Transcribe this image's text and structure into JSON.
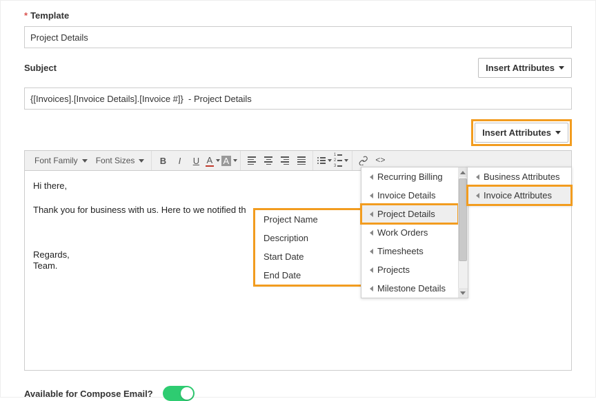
{
  "template": {
    "label": "Template",
    "value": "Project Details"
  },
  "subject": {
    "label": "Subject",
    "value": "{[Invoices].[Invoice Details].[Invoice #]}  - Project Details",
    "insert_btn": "Insert Attributes"
  },
  "body_insert_btn": "Insert Attributes",
  "toolbar": {
    "font_family": "Font Family",
    "font_sizes": "Font Sizes"
  },
  "editor": {
    "greeting": "Hi there,",
    "line": "Thank you for business with us. Here to we notified th",
    "regards1": "Regards,",
    "regards2": "Team."
  },
  "menus": {
    "top": [
      "Business Attributes",
      "Invoice Attributes"
    ],
    "mid": [
      "Recurring Billing",
      "Invoice Details",
      "Project Details",
      "Work Orders",
      "Timesheets",
      "Projects",
      "Milestone Details"
    ],
    "sub": [
      "Project Name",
      "Description",
      "Start Date",
      "End Date"
    ]
  },
  "footer": {
    "available_label": "Available for Compose Email?"
  }
}
